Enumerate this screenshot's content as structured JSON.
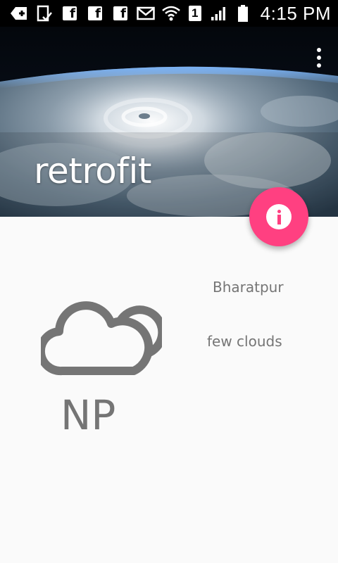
{
  "status_bar": {
    "left_icons": [
      "add-notification-icon",
      "sim-signal-icon",
      "facebook-icon",
      "facebook-icon",
      "facebook-icon",
      "mail-icon"
    ],
    "right_icons": [
      "wifi-icon",
      "sim-slot-icon",
      "signal-icon",
      "battery-icon"
    ],
    "sim_slot": "1",
    "time": "4:15 PM"
  },
  "header": {
    "title": "retrofit",
    "background": "earth-from-space-hurricane"
  },
  "fab": {
    "icon": "info-icon",
    "color": "#ff4081"
  },
  "weather": {
    "icon": "cloudy-icon",
    "country": "NP",
    "city": "Bharatpur",
    "description": "few clouds"
  },
  "colors": {
    "accent": "#ff4081",
    "text_secondary": "#757575",
    "background": "#fafafa"
  }
}
